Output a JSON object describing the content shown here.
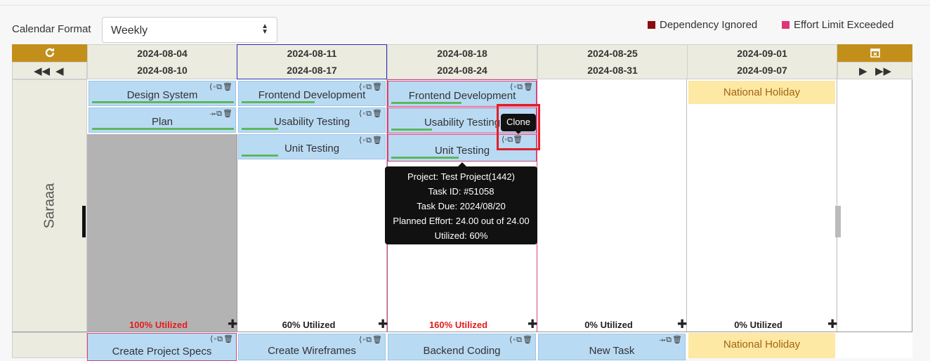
{
  "toolbar": {
    "calendar_format_label": "Calendar Format",
    "calendar_format_value": "Weekly"
  },
  "legend": [
    {
      "label": "Dependency Ignored",
      "color": "#8b0d0d"
    },
    {
      "label": "Effort Limit Exceeded",
      "color": "#e0337a"
    }
  ],
  "weeks": [
    {
      "start": "2024-08-04",
      "end": "2024-08-10"
    },
    {
      "start": "2024-08-11",
      "end": "2024-08-17"
    },
    {
      "start": "2024-08-18",
      "end": "2024-08-24"
    },
    {
      "start": "2024-08-25",
      "end": "2024-08-31"
    },
    {
      "start": "2024-09-01",
      "end": "2024-09-07"
    }
  ],
  "resource": {
    "name": "Saraaa"
  },
  "tasks": {
    "w1": [
      "Design System",
      "Plan"
    ],
    "w2": [
      "Frontend Development",
      "Usability Testing",
      "Unit Testing"
    ],
    "w3": [
      "Frontend Development",
      "Usability Testing",
      "Unit Testing"
    ],
    "w5_holiday": "National Holiday"
  },
  "utilization": [
    "100% Utilized",
    "60% Utilized",
    "160% Utilized",
    "0% Utilized",
    "0% Utilized"
  ],
  "tooltip": {
    "project": "Project: Test Project(1442)",
    "task_id": "Task ID: #51058",
    "due": "Task Due: 2024/08/20",
    "effort": "Planned Effort: 24.00 out of 24.00",
    "utilized": "Utilized: 60%"
  },
  "clone_tooltip": "Clone",
  "row2": {
    "tasks": [
      "Create Project Specs",
      "Create Wireframes",
      "Backend Coding",
      "New Task"
    ],
    "holiday": "National Holiday"
  },
  "icons": {
    "refresh": "refresh-icon",
    "calendar": "calendar-icon"
  }
}
